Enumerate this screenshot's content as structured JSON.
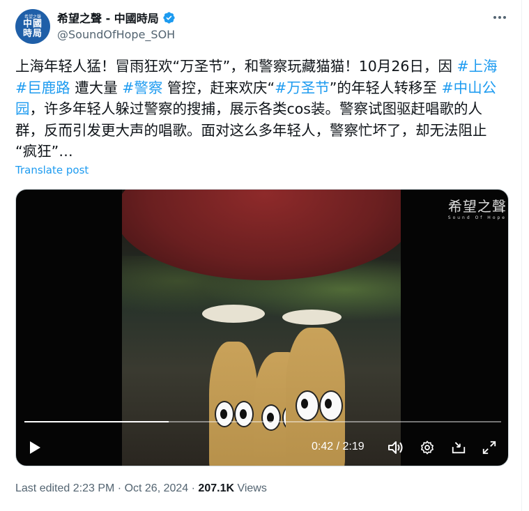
{
  "author": {
    "display_name": "希望之聲 - 中國時局",
    "handle": "@SoundOfHope_SOH",
    "avatar_top": "希望之聲",
    "avatar_line1": "中國",
    "avatar_line2": "時局",
    "verified": true
  },
  "tweet": {
    "segments": [
      {
        "t": "上海年轻人猛！冒雨狂欢“万圣节”，和警察玩藏猫猫！10月26日，因 ",
        "tag": false
      },
      {
        "t": "#上海",
        "tag": true
      },
      {
        "t": "\n",
        "tag": false
      },
      {
        "t": "#巨鹿路",
        "tag": true
      },
      {
        "t": " 遭大量 ",
        "tag": false
      },
      {
        "t": "#警察",
        "tag": true
      },
      {
        "t": " 管控，赶来欢庆“",
        "tag": false
      },
      {
        "t": "#万圣节",
        "tag": true
      },
      {
        "t": "”的年轻人转移至 ",
        "tag": false
      },
      {
        "t": "#中山公\n园",
        "tag": true
      },
      {
        "t": "，许多年轻人躲过警察的搜捕，展示各类cos装。警察试图驱赶唱歌的人\n群，反而引发更大声的唱歌。面对这么多年轻人，警察忙坏了，却无法阻止\n“疯狂”…",
        "tag": false
      }
    ],
    "translate_label": "Translate post"
  },
  "video": {
    "watermark_main": "希望之聲",
    "watermark_sub": "Sound Of Hope",
    "current_time": "0:42",
    "duration": "2:19",
    "progress_fraction": 0.302,
    "controls": [
      "play-icon",
      "volume-icon",
      "settings-icon",
      "dock-icon",
      "fullscreen-icon"
    ]
  },
  "footer": {
    "edited_label": "Last edited",
    "time": "2:23 PM",
    "sep": "·",
    "date": "Oct 26, 2024",
    "views_count": "207.1K",
    "views_label": "Views"
  },
  "colors": {
    "accent": "#1d9bf0",
    "muted": "#536471",
    "text": "#0f1419"
  }
}
